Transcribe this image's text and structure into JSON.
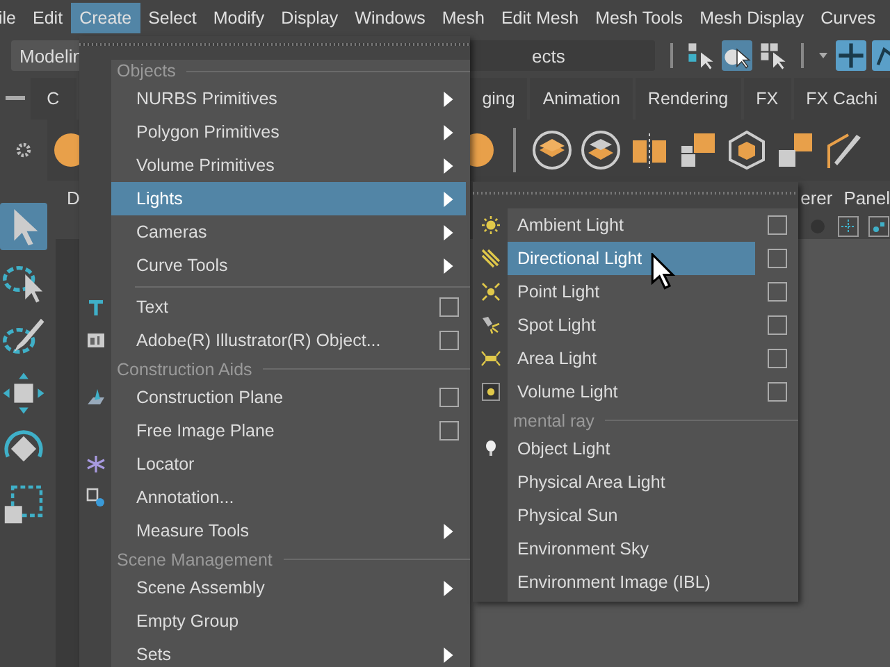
{
  "menubar": {
    "items": [
      {
        "label": "ile",
        "selected": false
      },
      {
        "label": "Edit",
        "selected": false
      },
      {
        "label": "Create",
        "selected": true
      },
      {
        "label": "Select",
        "selected": false
      },
      {
        "label": "Modify",
        "selected": false
      },
      {
        "label": "Display",
        "selected": false
      },
      {
        "label": "Windows",
        "selected": false
      },
      {
        "label": "Mesh",
        "selected": false
      },
      {
        "label": "Edit Mesh",
        "selected": false
      },
      {
        "label": "Mesh Tools",
        "selected": false
      },
      {
        "label": "Mesh Display",
        "selected": false
      },
      {
        "label": "Curves",
        "selected": false
      }
    ]
  },
  "status_line": {
    "mode_dropdown": "Modelin",
    "field_value": "ects"
  },
  "shelf": {
    "tabs": [
      "C",
      "ging",
      "Animation",
      "Rendering",
      "FX",
      "FX Cachi"
    ]
  },
  "panel": {
    "title": "D",
    "menu_items": [
      "erer",
      "Panel"
    ]
  },
  "create_menu": {
    "entries": [
      {
        "kind": "header",
        "label": "Objects"
      },
      {
        "kind": "item",
        "label": "NURBS Primitives",
        "submenu": true,
        "option_box": false,
        "selected": false
      },
      {
        "kind": "item",
        "label": "Polygon Primitives",
        "submenu": true,
        "option_box": false,
        "selected": false
      },
      {
        "kind": "item",
        "label": "Volume Primitives",
        "submenu": true,
        "option_box": false,
        "selected": false
      },
      {
        "kind": "item",
        "label": "Lights",
        "submenu": true,
        "option_box": false,
        "selected": true
      },
      {
        "kind": "item",
        "label": "Cameras",
        "submenu": true,
        "option_box": false,
        "selected": false
      },
      {
        "kind": "item",
        "label": "Curve Tools",
        "submenu": true,
        "option_box": false,
        "selected": false
      },
      {
        "kind": "separator"
      },
      {
        "kind": "item",
        "label": "Text",
        "submenu": false,
        "option_box": true,
        "selected": false
      },
      {
        "kind": "item",
        "label": "Adobe(R) Illustrator(R) Object...",
        "submenu": false,
        "option_box": true,
        "selected": false
      },
      {
        "kind": "header",
        "label": "Construction Aids"
      },
      {
        "kind": "item",
        "label": "Construction Plane",
        "submenu": false,
        "option_box": true,
        "selected": false
      },
      {
        "kind": "item",
        "label": "Free Image Plane",
        "submenu": false,
        "option_box": true,
        "selected": false
      },
      {
        "kind": "item",
        "label": "Locator",
        "submenu": false,
        "option_box": false,
        "selected": false
      },
      {
        "kind": "item",
        "label": "Annotation...",
        "submenu": false,
        "option_box": false,
        "selected": false
      },
      {
        "kind": "item",
        "label": "Measure Tools",
        "submenu": true,
        "option_box": false,
        "selected": false
      },
      {
        "kind": "header",
        "label": "Scene Management"
      },
      {
        "kind": "item",
        "label": "Scene Assembly",
        "submenu": true,
        "option_box": false,
        "selected": false
      },
      {
        "kind": "item",
        "label": "Empty Group",
        "submenu": false,
        "option_box": false,
        "selected": false
      },
      {
        "kind": "item",
        "label": "Sets",
        "submenu": true,
        "option_box": false,
        "selected": false
      }
    ]
  },
  "lights_menu": {
    "entries": [
      {
        "kind": "item",
        "label": "Ambient Light",
        "option_box": true,
        "selected": false
      },
      {
        "kind": "item",
        "label": "Directional Light",
        "option_box": true,
        "selected": true
      },
      {
        "kind": "item",
        "label": "Point Light",
        "option_box": true,
        "selected": false
      },
      {
        "kind": "item",
        "label": "Spot Light",
        "option_box": true,
        "selected": false
      },
      {
        "kind": "item",
        "label": "Area Light",
        "option_box": true,
        "selected": false
      },
      {
        "kind": "item",
        "label": "Volume Light",
        "option_box": true,
        "selected": false
      },
      {
        "kind": "header",
        "label": "mental ray"
      },
      {
        "kind": "item",
        "label": "Object Light",
        "option_box": false,
        "selected": false
      },
      {
        "kind": "item",
        "label": "Physical Area Light",
        "option_box": false,
        "selected": false
      },
      {
        "kind": "item",
        "label": "Physical Sun",
        "option_box": false,
        "selected": false
      },
      {
        "kind": "item",
        "label": "Environment Sky",
        "option_box": false,
        "selected": false
      },
      {
        "kind": "item",
        "label": "Environment Image (IBL)",
        "option_box": false,
        "selected": false
      }
    ]
  }
}
